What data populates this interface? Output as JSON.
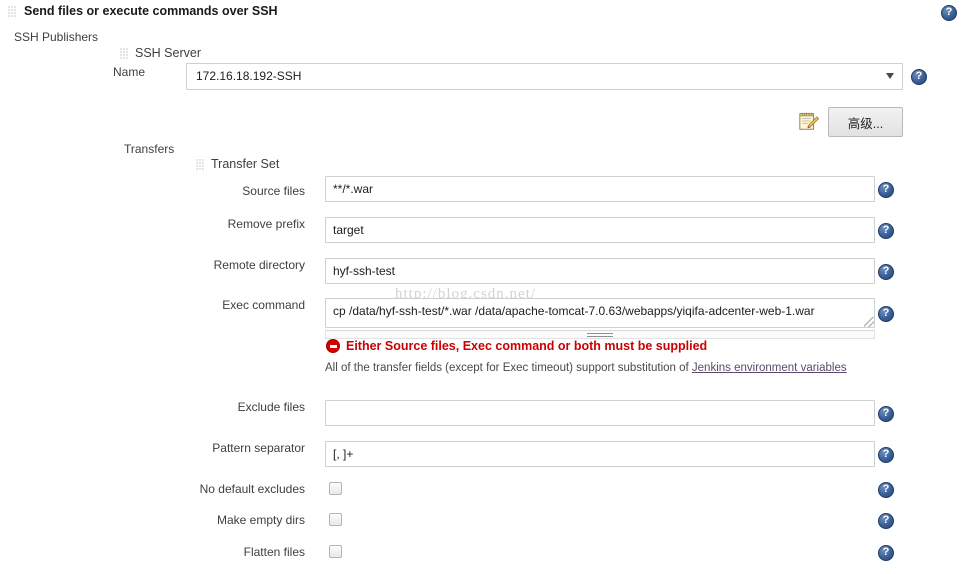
{
  "header": {
    "title": "Send files or execute commands over SSH",
    "grip_icon": "drag-grip-icon",
    "help_icon": "help-icon"
  },
  "watermark": "http://blog.csdn.net/",
  "publishers": {
    "label": "SSH Publishers"
  },
  "ssh_server": {
    "group_label": "SSH Server",
    "name_label": "Name",
    "name_value": "172.16.18.192-SSH",
    "dropdown_icon": "chevron-down-icon",
    "advanced_button": "高级...",
    "notepad_icon": "notepad-pencil-icon"
  },
  "transfers": {
    "label": "Transfers",
    "transfer_set_label": "Transfer Set",
    "fields": [
      {
        "label": "Source files",
        "value": "**/*.war",
        "name": "source-files"
      },
      {
        "label": "Remove prefix",
        "value": "target",
        "name": "remove-prefix"
      },
      {
        "label": "Remote directory",
        "value": "hyf-ssh-test",
        "name": "remote-directory"
      }
    ],
    "exec": {
      "label": "Exec command",
      "value": "cp /data/hyf-ssh-test/*.war /data/apache-tomcat-7.0.63/webapps/yiqifa-adcenter-web-1.war"
    },
    "error": {
      "text": "Either Source files, Exec command or both must be supplied",
      "icon": "error-circle-icon",
      "color": "#cc0000"
    },
    "note": {
      "text_before": "All of the transfer fields (except for Exec timeout) support substitution of ",
      "link_text": "Jenkins environment variables"
    },
    "fields2": [
      {
        "label": "Exclude files",
        "value": "",
        "name": "exclude-files"
      },
      {
        "label": "Pattern separator",
        "value": "[, ]+",
        "name": "pattern-separator"
      }
    ],
    "checkboxes": [
      {
        "label": "No default excludes",
        "checked": false,
        "name": "no-default-excludes"
      },
      {
        "label": "Make empty dirs",
        "checked": false,
        "name": "make-empty-dirs"
      },
      {
        "label": "Flatten files",
        "checked": false,
        "name": "flatten-files"
      }
    ]
  }
}
